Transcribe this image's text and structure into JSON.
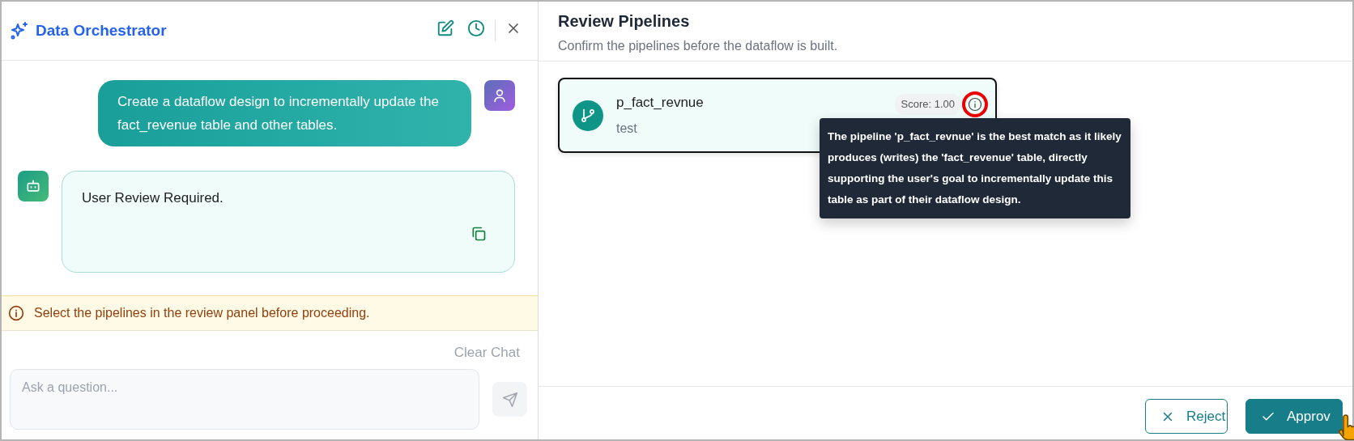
{
  "chat": {
    "title": "Data Orchestrator",
    "messages": [
      {
        "kind": "user",
        "text": "Create a dataflow design to incrementally update the fact_revenue table and other tables."
      },
      {
        "kind": "bot",
        "text": "User Review Required."
      }
    ],
    "warning": "Select the pipelines in the review panel before proceeding.",
    "clear_label": "Clear Chat",
    "input": {
      "placeholder": "Ask a question..."
    }
  },
  "review": {
    "title": "Review Pipelines",
    "subtitle": "Confirm the pipelines before the dataflow is built.",
    "pipelines": [
      {
        "name": "p_fact_revnue",
        "description": "test",
        "score": "Score: 1.00",
        "selected": true,
        "tooltip": "The pipeline 'p_fact_revnue' is the best match as it likely produces (writes) the 'fact_revenue' table, directly supporting the user's goal to incrementally update this table as part of their dataflow design."
      }
    ],
    "buttons": [
      {
        "kind": "reject",
        "label": "Reject"
      },
      {
        "kind": "approve",
        "label": "Approv"
      }
    ]
  }
}
